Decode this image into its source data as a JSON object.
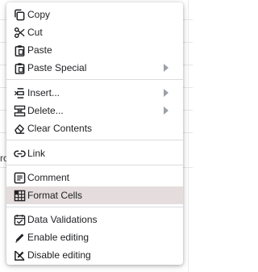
{
  "background": {
    "partial_cell_text": "ro"
  },
  "menu": {
    "items": {
      "copy": {
        "label": "Copy",
        "icon": "copy-icon"
      },
      "cut": {
        "label": "Cut",
        "icon": "scissors-icon"
      },
      "paste": {
        "label": "Paste",
        "icon": "clipboard-icon"
      },
      "paste_special": {
        "label": "Paste Special",
        "icon": "clipboard-icon",
        "has_submenu": true
      },
      "insert": {
        "label": "Insert...",
        "icon": "insert-icon",
        "has_submenu": true
      },
      "delete": {
        "label": "Delete...",
        "icon": "delete-icon",
        "has_submenu": true
      },
      "clear_contents": {
        "label": "Clear Contents",
        "icon": "eraser-icon"
      },
      "link": {
        "label": "Link",
        "icon": "link-icon"
      },
      "comment": {
        "label": "Comment",
        "icon": "comment-icon"
      },
      "format_cells": {
        "label": "Format Cells",
        "icon": "format-cells-icon",
        "highlighted": true
      },
      "data_validations": {
        "label": "Data Validations",
        "icon": "calendar-check-icon"
      },
      "enable_editing": {
        "label": "Enable editing",
        "icon": "pencil-icon"
      },
      "disable_editing": {
        "label": "Disable editing",
        "icon": "pencil-off-icon"
      }
    }
  },
  "colors": {
    "highlight": "#e5dddd",
    "text": "#202124",
    "icon": "#202124",
    "arrow": "#9aa0a6",
    "separator": "#dadce0"
  }
}
